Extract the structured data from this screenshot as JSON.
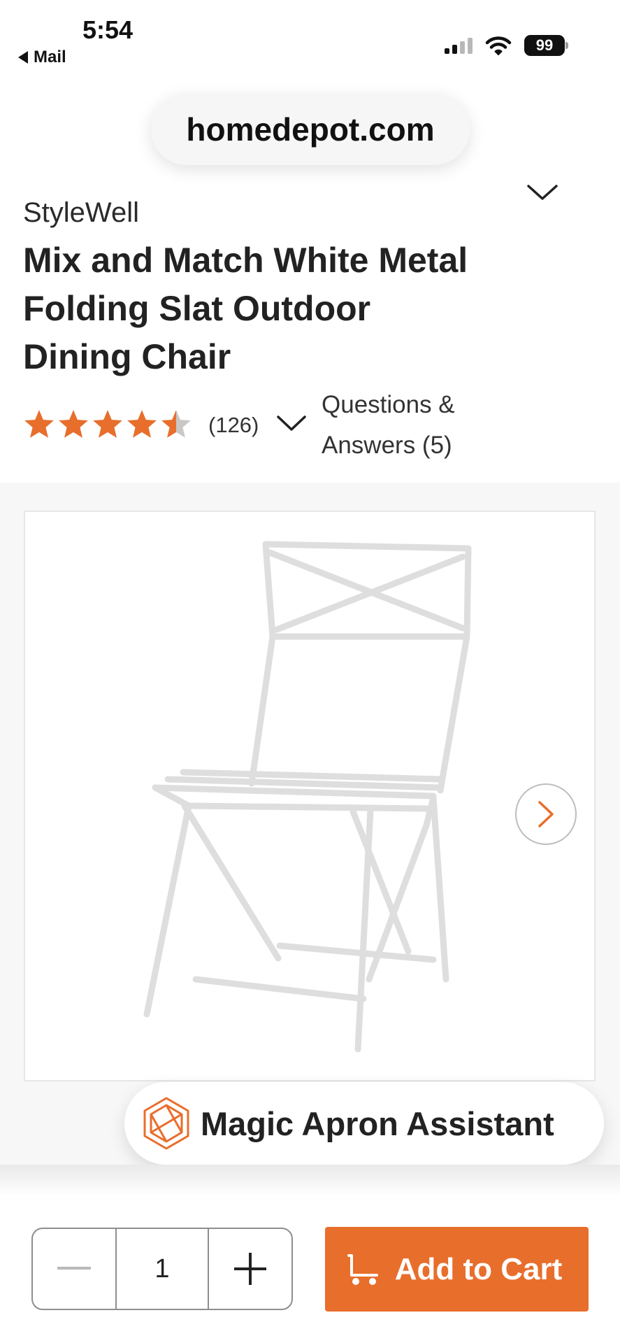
{
  "status_bar": {
    "time": "5:54",
    "back_app": "Mail",
    "battery": "99"
  },
  "browser": {
    "url": "homedepot.com"
  },
  "product": {
    "brand": "StyleWell",
    "title": "Mix and Match White Metal Folding Slat Outdoor Dining Chair",
    "rating": {
      "stars": 4.5,
      "max_stars": 5,
      "count_label": "(126)"
    },
    "qa_label": "Questions & Answers (5)",
    "image_alt": "white folding chair"
  },
  "assistant": {
    "label": "Magic Apron Assistant"
  },
  "purchase": {
    "quantity": "1",
    "add_to_cart_label": "Add to Cart"
  },
  "icons": {
    "back": "back-triangle-icon",
    "signal": "cellular-signal-icon",
    "wifi": "wifi-icon",
    "battery": "battery-icon",
    "header_chevron": "chevron-down-icon",
    "rating_chevron": "chevron-down-icon",
    "star": "star-icon",
    "next": "chevron-right-icon",
    "assistant": "magic-apron-icon",
    "minus": "minus-icon",
    "plus": "plus-icon",
    "cart": "cart-icon"
  },
  "colors": {
    "accent": "#e86e2c",
    "star_empty": "#c8c8c8",
    "text": "#222222"
  }
}
